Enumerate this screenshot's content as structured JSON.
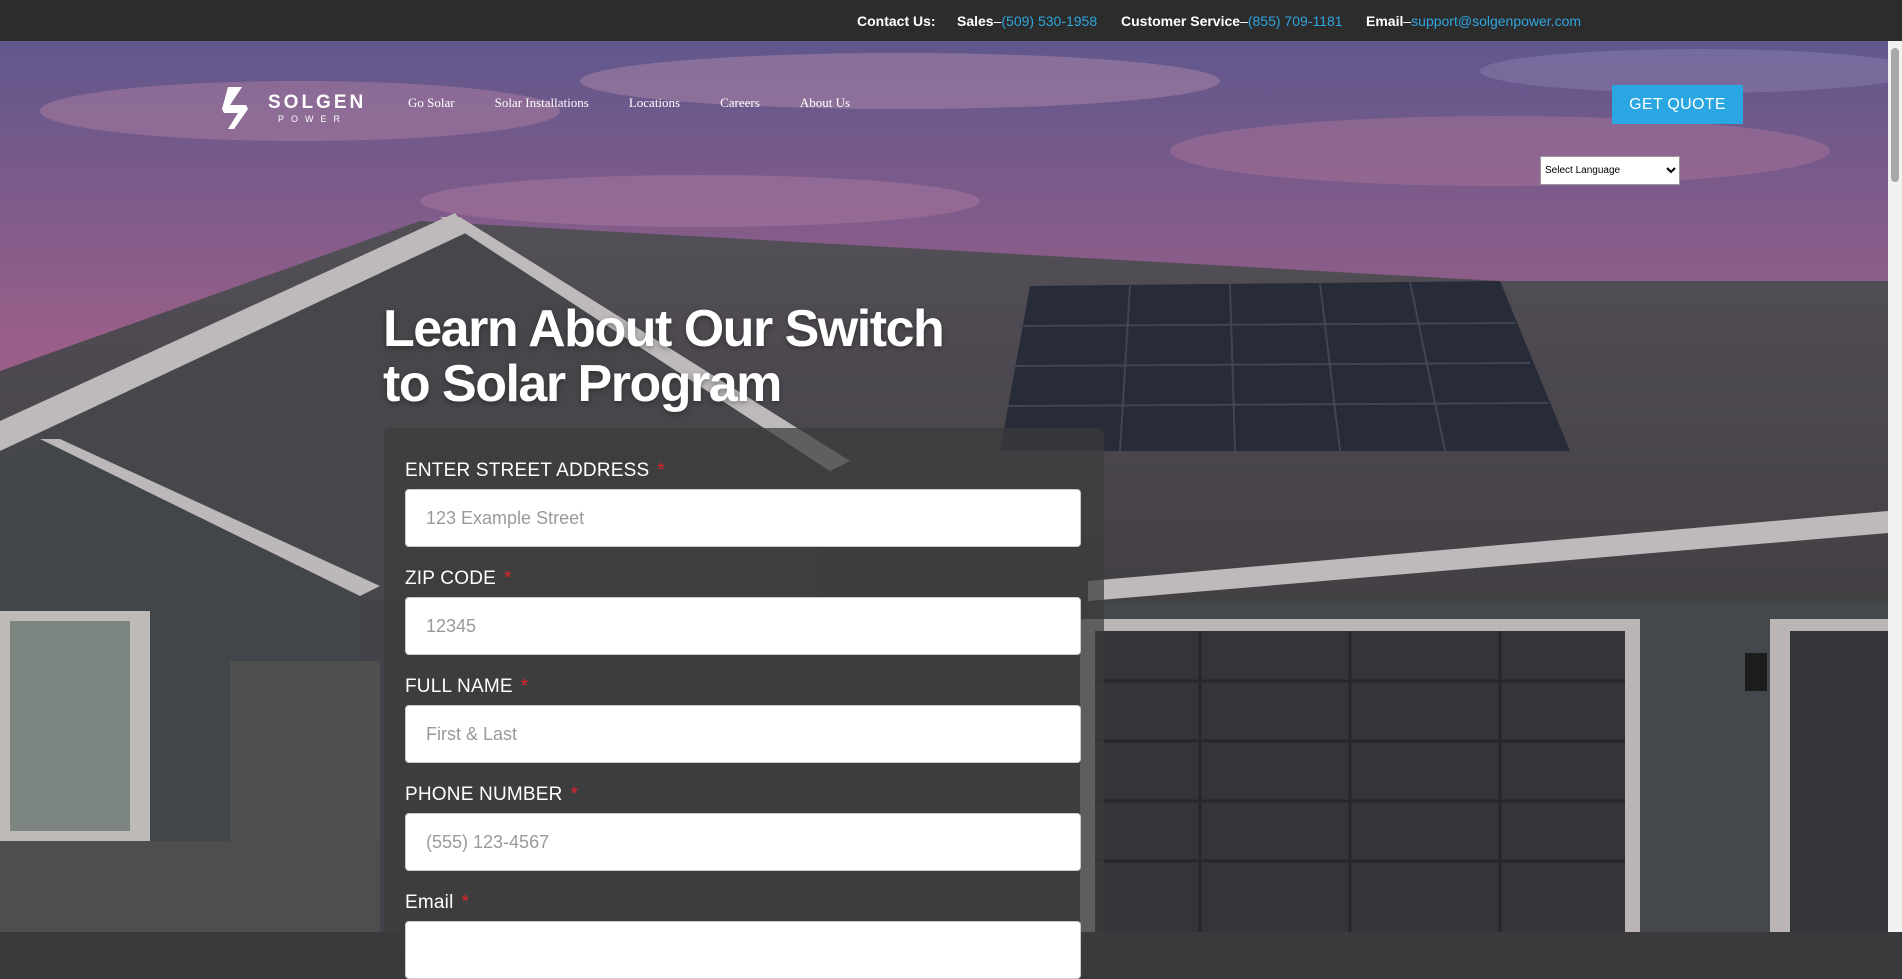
{
  "topbar": {
    "contact_label": "Contact Us:",
    "sales_label": "Sales",
    "sales_sep": "–",
    "sales_phone": "(509) 530-1958",
    "cs_label": "Customer Service",
    "cs_sep": "–",
    "cs_phone": "(855) 709-1181",
    "email_label": "Email",
    "email_sep": "–",
    "email_value": "support@solgenpower.com"
  },
  "logo": {
    "word1": "SOLGEN",
    "word2": "POWER"
  },
  "nav": {
    "items": [
      {
        "label": "Go Solar"
      },
      {
        "label": "Solar Installations"
      },
      {
        "label": "Locations"
      },
      {
        "label": "Careers"
      },
      {
        "label": "About Us"
      }
    ]
  },
  "header": {
    "quote_button": "GET QUOTE",
    "language_selected": "Select Language"
  },
  "hero": {
    "headline_line1": "Learn About Our Switch",
    "headline_line2": "to Solar Program"
  },
  "form": {
    "street": {
      "label": "ENTER STREET ADDRESS",
      "required": "*",
      "placeholder": "123 Example Street",
      "value": ""
    },
    "zip": {
      "label": "ZIP CODE",
      "required": "*",
      "placeholder": "12345",
      "value": ""
    },
    "name": {
      "label": "FULL NAME",
      "required": "*",
      "placeholder": "First & Last",
      "value": ""
    },
    "phone": {
      "label": "PHONE NUMBER",
      "required": "*",
      "placeholder": "(555) 123-4567",
      "value": ""
    },
    "email": {
      "label": "Email",
      "required": "*",
      "placeholder": "",
      "value": ""
    }
  },
  "colors": {
    "accent": "#2aa7e3",
    "link": "#2fa6e0",
    "required": "#e02424",
    "topbar": "#2c2c2c"
  }
}
